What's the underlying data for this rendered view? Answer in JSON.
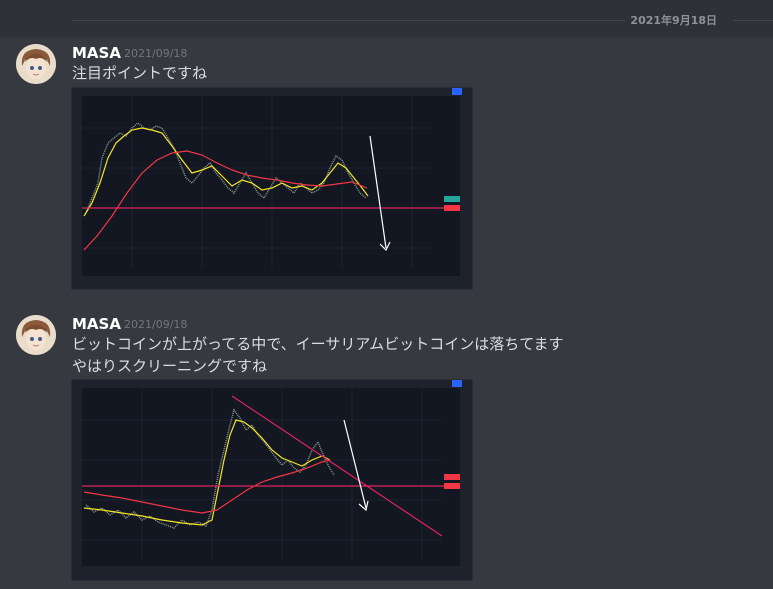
{
  "divider": {
    "date": "2021年9月18日"
  },
  "messages": [
    {
      "author": "MASA",
      "timestamp": "2021/09/18",
      "lines": [
        "注目ポイントですね"
      ]
    },
    {
      "author": "MASA",
      "timestamp": "2021/09/18",
      "lines": [
        "ビットコインが上がってる中で、イーサリアムビットコインは落ちてます",
        "やはりスクリーニングですね"
      ]
    }
  ],
  "colors": {
    "background": "#36393f",
    "chart_bg": "#131722",
    "ma_fast": "#f5e623",
    "ma_slow": "#f23645",
    "hline": "#e0245e",
    "arrow": "#ffffff"
  }
}
